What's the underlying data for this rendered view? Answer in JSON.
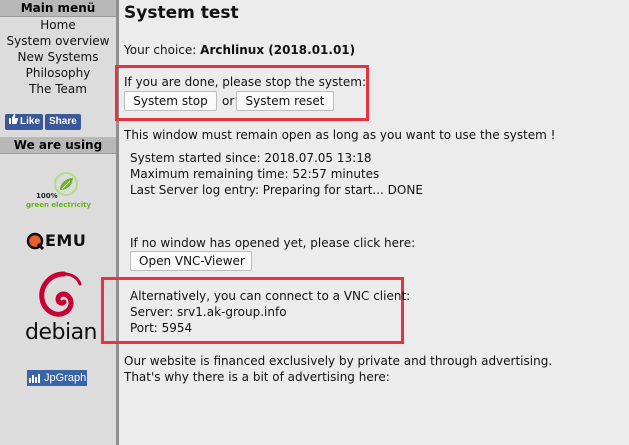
{
  "sidebar": {
    "main_menu_title": "Main menü",
    "nav": [
      "Home",
      "System overview",
      "New Systems",
      "Philosophy",
      "The Team"
    ],
    "fb_like": "Like",
    "fb_share": "Share",
    "we_are_using_title": "We are using",
    "logos": {
      "green_electricity_top": "100%",
      "green_electricity_bottom": "green electricity",
      "qemu": "EMU",
      "debian": "debian",
      "jpgraph": "JpGraph"
    }
  },
  "main": {
    "title": "System test",
    "choice_label": "Your choice: ",
    "choice_value": "Archlinux (2018.01.01)",
    "stop_prompt": "If you are done, please stop the system:",
    "stop_button": "System stop",
    "or_text": "or",
    "reset_button": "System reset",
    "window_notice": "This window must remain open as long as you want to use the system !",
    "started": "System started since: 2018.07.05 13:18",
    "remaining": "Maximum remaining time: 52:57 minutes",
    "log": "Last Server log entry: Preparing for start... DONE",
    "no_window": "If no window has opened yet, please click here:",
    "vnc_button": "Open VNC-Viewer",
    "alt_vnc": "Alternatively, you can connect to a VNC client:",
    "server": "Server: srv1.ak-group.info",
    "port": "Port: 5954",
    "finance": "Our website is financed exclusively by private and through advertising.",
    "advert": "That's why there is a bit of advertising here:"
  },
  "colors": {
    "highlight": "#e8323f",
    "facebook": "#3b5998",
    "debian": "#c70036",
    "green": "#6ab023"
  }
}
